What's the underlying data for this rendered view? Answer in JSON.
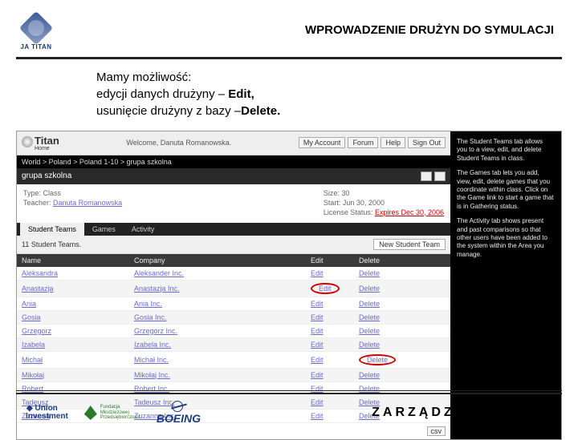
{
  "header": {
    "logo_text": "JA TITAN",
    "slide_title": "WPROWADZENIE DRUŻYN DO SYMULACJI"
  },
  "bullets": {
    "line1": "Mamy możliwość:",
    "line2a": "edycji  danych drużyny – ",
    "line2b": "Edit,",
    "line3a": "usunięcie  drużyny z bazy –",
    "line3b": "Delete."
  },
  "app": {
    "brand": "Titan",
    "brand_sub": "Home",
    "welcome": "Welcome, Danuta Romanowska.",
    "top_buttons": [
      "My Account",
      "Forum",
      "Help",
      "Sign Out"
    ],
    "breadcrumb": "World > Poland > Poland 1-10 > grupa szkolna",
    "section_title": "grupa szkolna",
    "info_left": {
      "type_label": "Type:",
      "type_value": "Class",
      "teacher_label": "Teacher:",
      "teacher_value": "Danuta Romanowska"
    },
    "info_right": {
      "size_label": "Size:",
      "size_value": "30",
      "start_label": "Start:",
      "start_value": "Jun 30, 2000",
      "license_label": "License Status:",
      "license_value": "Expires Dec 30, 2006"
    },
    "tabs": [
      "Student Teams",
      "Games",
      "Activity"
    ],
    "teams_count": "11 Student Teams.",
    "new_team_btn": "New Student Team",
    "columns": [
      "Name",
      "Company",
      "Edit",
      "Delete"
    ],
    "rows": [
      {
        "name": "Aleksandra",
        "company": "Aleksander Inc.",
        "edit": "Edit",
        "del": "Delete",
        "hi_edit": false,
        "hi_del": false
      },
      {
        "name": "Anastazja",
        "company": "Anastazja Inc.",
        "edit": "Edit",
        "del": "Delete",
        "hi_edit": true,
        "hi_del": false
      },
      {
        "name": "Ania",
        "company": "Ania Inc.",
        "edit": "Edit",
        "del": "Delete",
        "hi_edit": false,
        "hi_del": false
      },
      {
        "name": "Gosia",
        "company": "Gosia Inc.",
        "edit": "Edit",
        "del": "Delete",
        "hi_edit": false,
        "hi_del": false
      },
      {
        "name": "Grzegorz",
        "company": "Grzegorz Inc.",
        "edit": "Edit",
        "del": "Delete",
        "hi_edit": false,
        "hi_del": false
      },
      {
        "name": "Izabela",
        "company": "Izabela Inc.",
        "edit": "Edit",
        "del": "Delete",
        "hi_edit": false,
        "hi_del": false
      },
      {
        "name": "Michał",
        "company": "Michał Inc.",
        "edit": "Edit",
        "del": "Delete",
        "hi_edit": false,
        "hi_del": true
      },
      {
        "name": "Mikołaj",
        "company": "Mikołaj Inc.",
        "edit": "Edit",
        "del": "Delete",
        "hi_edit": false,
        "hi_del": false
      },
      {
        "name": "Robert",
        "company": "Robert Inc.",
        "edit": "Edit",
        "del": "Delete",
        "hi_edit": false,
        "hi_del": false
      },
      {
        "name": "Tadeusz",
        "company": "Tadeusz Inc.",
        "edit": "Edit",
        "del": "Delete",
        "hi_edit": false,
        "hi_del": false
      },
      {
        "name": "Zuzanna",
        "company": "Zuzanna Inc.",
        "edit": "Edit",
        "del": "Delete",
        "hi_edit": false,
        "hi_del": false
      }
    ],
    "pager": "csv",
    "side": {
      "p1": "The Student Teams tab allows you to a view, edit, and delete Student Teams in class.",
      "p2": "The Games tab lets you add, view, edit, delete games that you coordinate within class. Click on the Game link to start a game that is in Gathering status.",
      "p3": "The Activity tab shows present and past comparisons so that other users have been added to the system within the Area you manage."
    }
  },
  "footer": {
    "union1": "Union",
    "union2": "Investment",
    "fundacja": "Fundacja\nMłodzieżowej\nPrzedsiębiorczości",
    "boeing": "BOEING",
    "title": "ZARZĄDZANIE FIRMĄ"
  }
}
